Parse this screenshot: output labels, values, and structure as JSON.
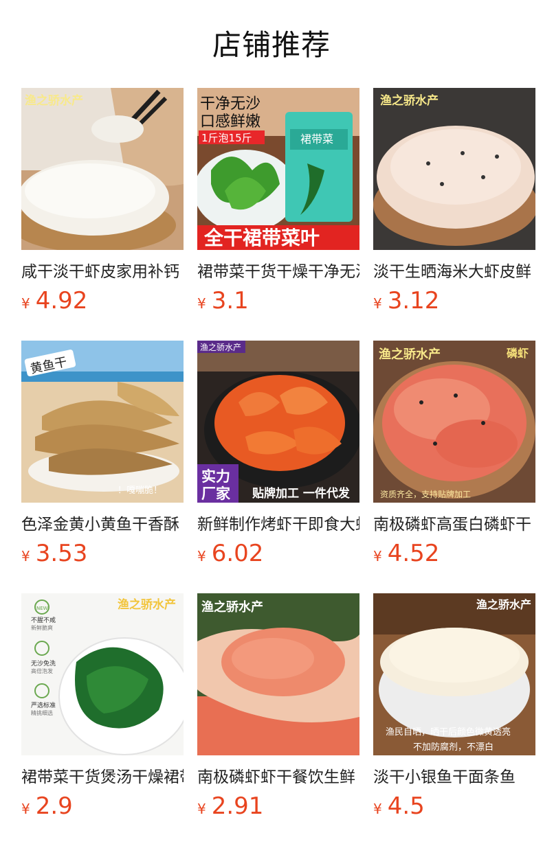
{
  "page": {
    "title": "店铺推荐"
  },
  "currency": "¥",
  "products": [
    {
      "name": "咸干淡干虾皮家用补钙",
      "price": "4.92",
      "image_text": [
        "渔之骄水产"
      ]
    },
    {
      "name": "裙带菜干货干燥干净无沙",
      "price": "3.1",
      "image_text": [
        "干净无沙",
        "口感鲜嫩",
        "1斤泡15斤",
        "裙带菜",
        "全干裙带菜叶"
      ]
    },
    {
      "name": "淡干生晒海米大虾皮鲜",
      "price": "3.12",
      "image_text": [
        "渔之骄水产"
      ]
    },
    {
      "name": "色泽金黄小黄鱼干香酥",
      "price": "3.53",
      "image_text": [
        "黄鱼干",
        "！嘎嘣脆！"
      ]
    },
    {
      "name": "新鲜制作烤虾干即食大虾",
      "price": "6.02",
      "image_text": [
        "渔之骄水产",
        "实力",
        "厂家",
        "贴牌加工 一件代发"
      ]
    },
    {
      "name": "南极磷虾高蛋白磷虾干",
      "price": "4.52",
      "image_text": [
        "渔之骄水产",
        "磷虾",
        "资质齐全，支持贴牌加工"
      ]
    },
    {
      "name": "裙带菜干货煲汤干燥裙带",
      "price": "2.9",
      "image_text": [
        "渔之骄水产",
        "NEW",
        "不腥不咸",
        "新鲜脆爽",
        "无沙免洗",
        "高倍泡发",
        "严选标准",
        "精挑细选"
      ]
    },
    {
      "name": "南极磷虾虾干餐饮生鲜",
      "price": "2.91",
      "image_text": [
        "渔之骄水产"
      ]
    },
    {
      "name": "淡干小银鱼干面条鱼",
      "price": "4.5",
      "image_text": [
        "渔之骄水产",
        "渔民自晒，晒干后颜色微黄透亮",
        "不加防腐剂，不漂白"
      ]
    }
  ]
}
